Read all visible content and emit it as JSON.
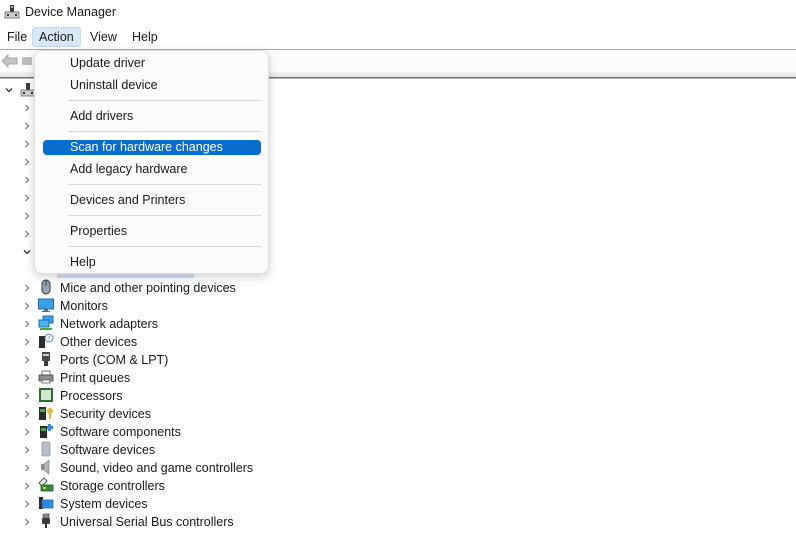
{
  "window": {
    "title": "Device Manager",
    "icon": "device-manager-icon"
  },
  "menubar": {
    "items": [
      {
        "label": "File",
        "active": false
      },
      {
        "label": "Action",
        "active": true
      },
      {
        "label": "View",
        "active": false
      },
      {
        "label": "Help",
        "active": false
      }
    ]
  },
  "toolbar": {
    "back_icon": "back-arrow-icon",
    "forward_icon": "forward-icon"
  },
  "action_menu": {
    "items": [
      {
        "label": "Update driver",
        "highlighted": false
      },
      {
        "label": "Uninstall device",
        "highlighted": false
      },
      {
        "label": "Add drivers",
        "highlighted": false
      },
      {
        "label": "Scan for hardware changes",
        "highlighted": true
      },
      {
        "label": "Add legacy hardware",
        "highlighted": false
      },
      {
        "label": "Devices and Printers",
        "highlighted": false
      },
      {
        "label": "Properties",
        "highlighted": false
      },
      {
        "label": "Help",
        "highlighted": false
      }
    ]
  },
  "tree": {
    "root_expanded": true,
    "hidden_collapsed_count": 8,
    "hidden_expanded_count": 1,
    "visible_items": [
      {
        "label": "Mice and other pointing devices",
        "icon": "mouse-icon"
      },
      {
        "label": "Monitors",
        "icon": "monitor-icon"
      },
      {
        "label": "Network adapters",
        "icon": "network-adapter-icon"
      },
      {
        "label": "Other devices",
        "icon": "unknown-device-icon"
      },
      {
        "label": "Ports (COM & LPT)",
        "icon": "port-icon"
      },
      {
        "label": "Print queues",
        "icon": "printer-icon"
      },
      {
        "label": "Processors",
        "icon": "processor-icon"
      },
      {
        "label": "Security devices",
        "icon": "security-key-icon"
      },
      {
        "label": "Software components",
        "icon": "software-component-icon"
      },
      {
        "label": "Software devices",
        "icon": "software-device-icon"
      },
      {
        "label": "Sound, video and game controllers",
        "icon": "speaker-icon"
      },
      {
        "label": "Storage controllers",
        "icon": "storage-controller-icon"
      },
      {
        "label": "System devices",
        "icon": "system-device-icon"
      },
      {
        "label": "Universal Serial Bus controllers",
        "icon": "usb-icon"
      }
    ]
  }
}
